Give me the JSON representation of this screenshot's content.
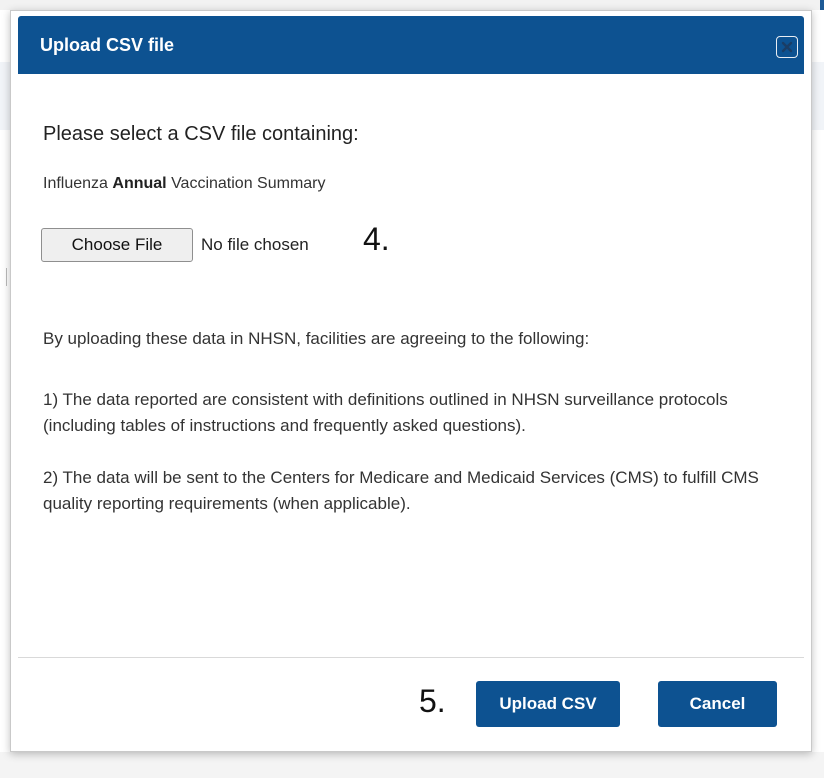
{
  "dialog": {
    "title": "Upload CSV file",
    "close_icon": "close-icon"
  },
  "content": {
    "heading": "Please select a CSV file containing:",
    "subtitle_part1": "Influenza",
    "subtitle_bold": "Annual",
    "subtitle_part2": "Vaccination Summary",
    "file_button_label": "Choose File",
    "file_status": "No file chosen",
    "step4_label": "4.",
    "agreement_intro": "By uploading these data in NHSN, facilities are agreeing to the following:",
    "agreement_item1": "1) The data reported are consistent with definitions outlined in NHSN surveillance protocols (including tables of instructions and frequently asked questions).",
    "agreement_item2": "2) The data will be sent to the Centers for Medicare and Medicaid Services (CMS) to fulfill CMS quality reporting requirements (when applicable)."
  },
  "footer": {
    "step5_label": "5.",
    "upload_label": "Upload CSV",
    "cancel_label": "Cancel"
  },
  "colors": {
    "header_bg": "#0d5291",
    "primary_button": "#0d5291"
  }
}
